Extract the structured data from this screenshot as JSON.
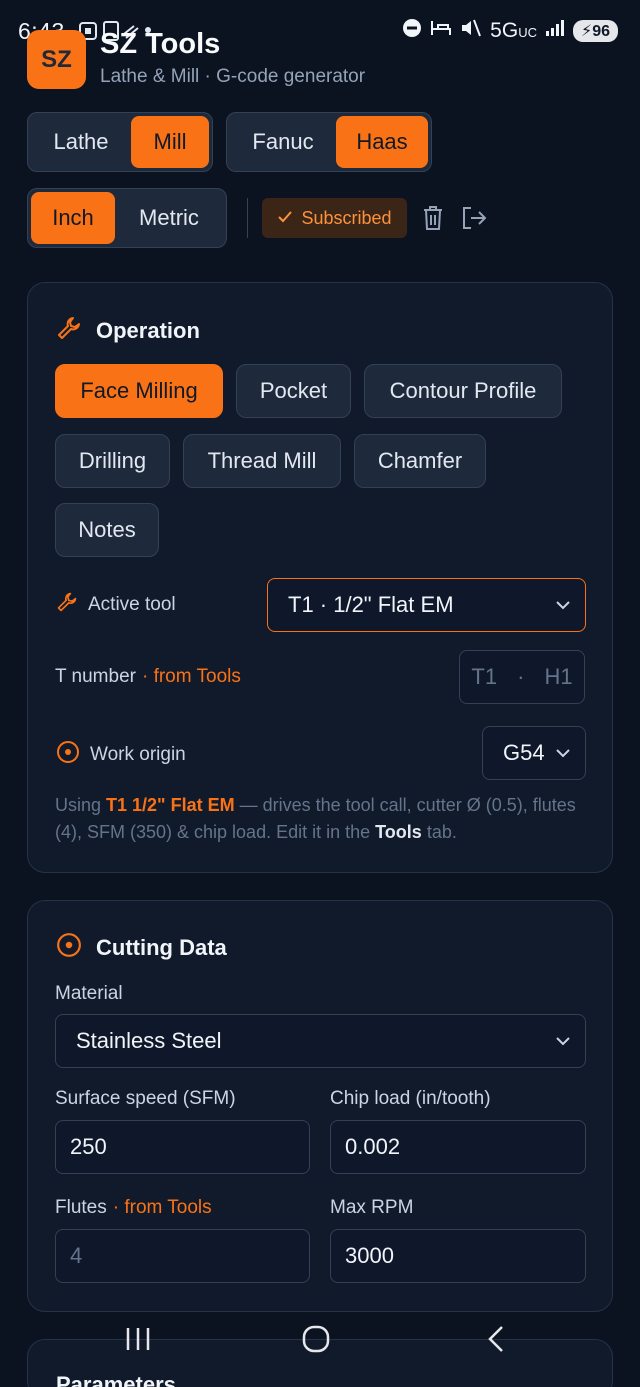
{
  "status_bar": {
    "time": "6:43",
    "network": "5G",
    "network_sub": "UC",
    "battery": "96"
  },
  "header": {
    "logo_text": "SZ",
    "title": "SZ Tools",
    "subtitle": "Lathe & Mill · G-code generator"
  },
  "machine_toggle": {
    "options": [
      "Lathe",
      "Mill"
    ],
    "selected": "Mill"
  },
  "control_toggle": {
    "options": [
      "Fanuc",
      "Haas"
    ],
    "selected": "Haas"
  },
  "unit_toggle": {
    "options": [
      "Inch",
      "Metric"
    ],
    "selected": "Inch"
  },
  "subscription": {
    "label": "Subscribed"
  },
  "operation": {
    "title": "Operation",
    "chips": [
      "Face Milling",
      "Pocket",
      "Contour Profile",
      "Drilling",
      "Thread Mill",
      "Chamfer",
      "Notes"
    ],
    "selected": "Face Milling",
    "active_tool_label": "Active tool",
    "active_tool_value": "T1 · 1/2\" Flat EM",
    "t_number_label": "T number",
    "t_number_from": "· from Tools",
    "t_value": "T1",
    "t_sep": "·",
    "h_value": "H1",
    "work_origin_label": "Work origin",
    "work_origin_value": "G54",
    "note_prefix": "Using ",
    "note_tool": "T1 1/2\" Flat EM",
    "note_middle": " — drives the tool call, cutter Ø (0.5), flutes (4), SFM (350) & chip load. Edit it in the ",
    "note_tab": "Tools",
    "note_suffix": " tab."
  },
  "cutting_data": {
    "title": "Cutting Data",
    "material_label": "Material",
    "material_value": "Stainless Steel",
    "sfm_label": "Surface speed (SFM)",
    "sfm_value": "250",
    "chipload_label": "Chip load (in/tooth)",
    "chipload_value": "0.002",
    "flutes_label": "Flutes",
    "flutes_from": "· from Tools",
    "flutes_value": "4",
    "maxrpm_label": "Max RPM",
    "maxrpm_value": "3000"
  },
  "parameters": {
    "title": "Parameters"
  },
  "colors": {
    "accent": "#f97316",
    "background": "#0b1220",
    "card": "#111a2b"
  }
}
